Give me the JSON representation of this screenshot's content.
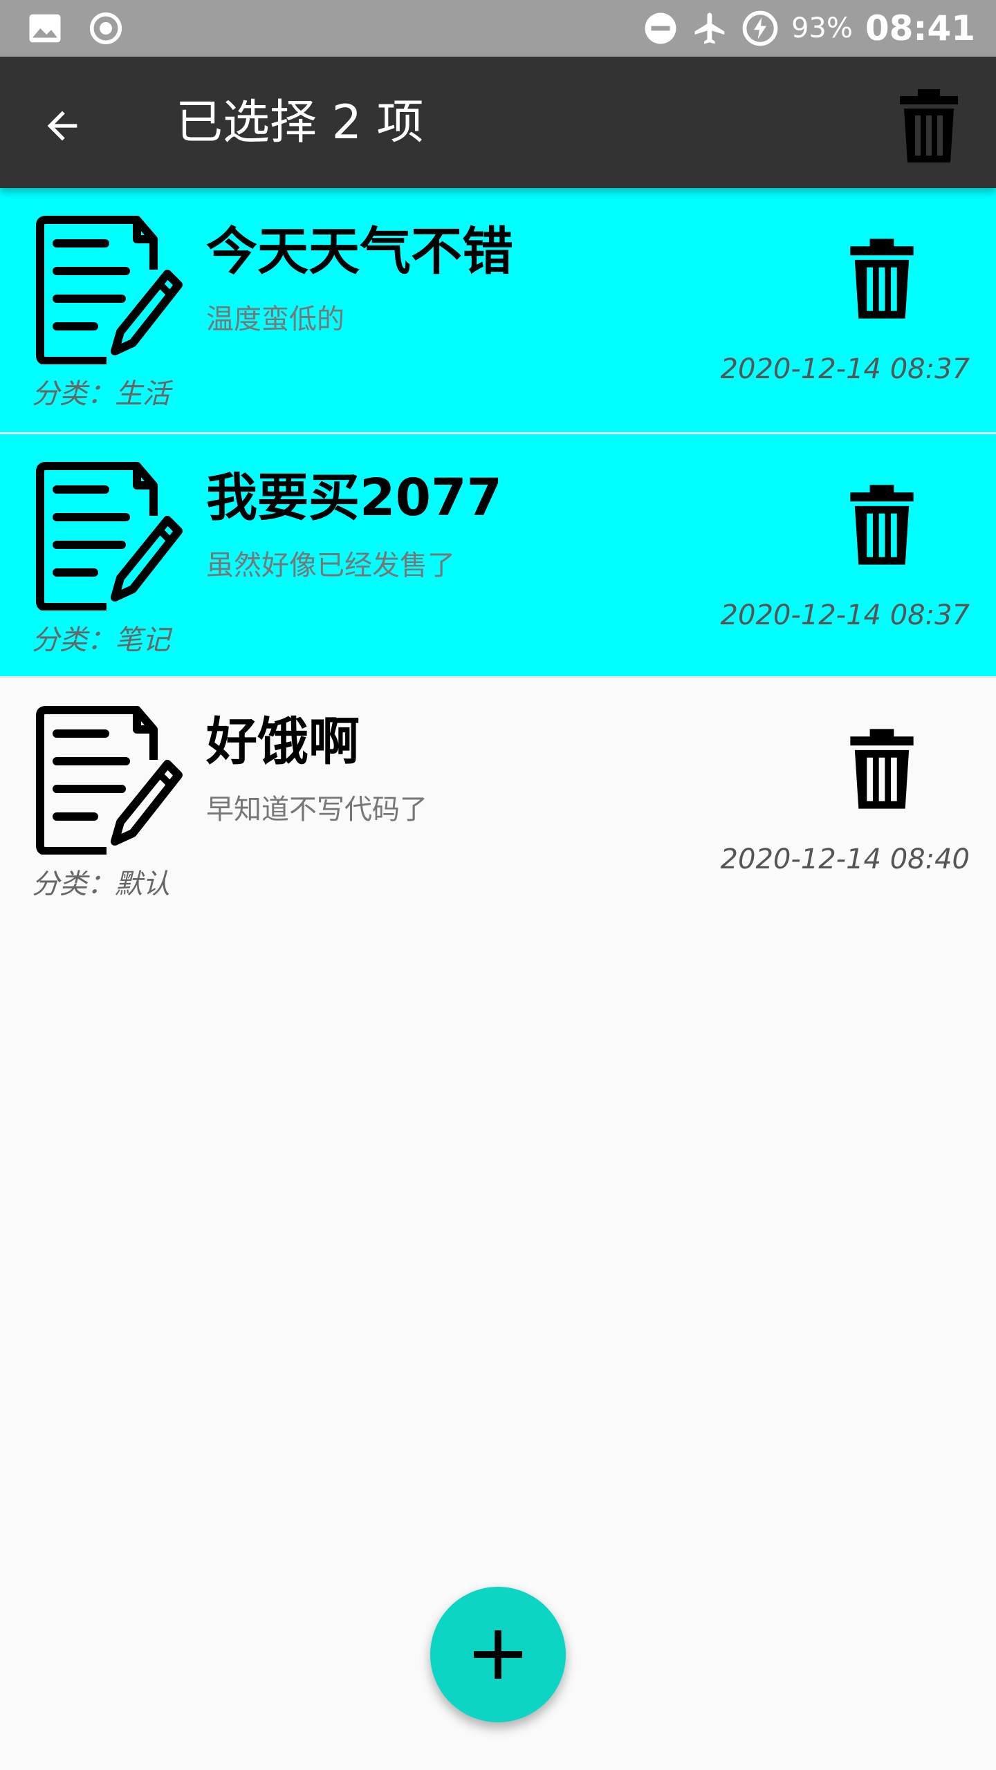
{
  "status_bar": {
    "battery_text": "93%",
    "time": "08:41",
    "icons": [
      "image-icon",
      "record-icon",
      "do-not-disturb-icon",
      "airplane-mode-icon",
      "battery-charging-icon"
    ]
  },
  "action_bar": {
    "title": "已选择 2 项",
    "back_icon": "back-arrow-icon",
    "delete_icon": "trash-icon"
  },
  "notes": [
    {
      "title": "今天天气不错",
      "content": "温度蛮低的",
      "category": "分类：生活",
      "date": "2020-12-14 08:37",
      "selected": true
    },
    {
      "title": "我要买2077",
      "content": "虽然好像已经发售了",
      "category": "分类：笔记",
      "date": "2020-12-14 08:37",
      "selected": true
    },
    {
      "title": "好饿啊",
      "content": "早知道不写代码了",
      "category": "分类：默认",
      "date": "2020-12-14 08:40",
      "selected": false
    }
  ],
  "colors": {
    "selected_background": "#00ffff",
    "action_bar": "#333333",
    "status_bar": "#9e9e9e",
    "fab": "#0cd6c3",
    "page_background": "#fafafa"
  },
  "fab": {
    "icon": "plus-icon"
  }
}
